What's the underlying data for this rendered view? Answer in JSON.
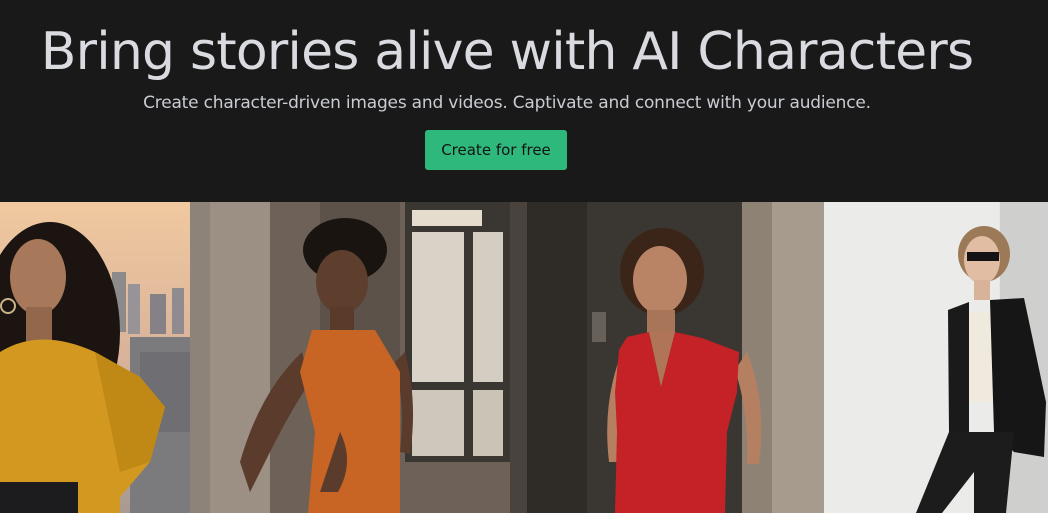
{
  "hero": {
    "headline": "Bring stories alive with AI Characters",
    "subhead": "Create character-driven images and videos. Captivate and connect with your audience.",
    "cta_label": "Create for free"
  },
  "colors": {
    "background": "#191919",
    "headline_text": "#d9dbe0",
    "cta_background": "#2fb87c"
  },
  "gallery": {
    "images": [
      {
        "name": "woman-yellow-sweater-photo"
      },
      {
        "name": "woman-orange-knit-dress-photo"
      },
      {
        "name": "woman-red-dress-photo"
      },
      {
        "name": "woman-black-suit-photo"
      }
    ]
  }
}
